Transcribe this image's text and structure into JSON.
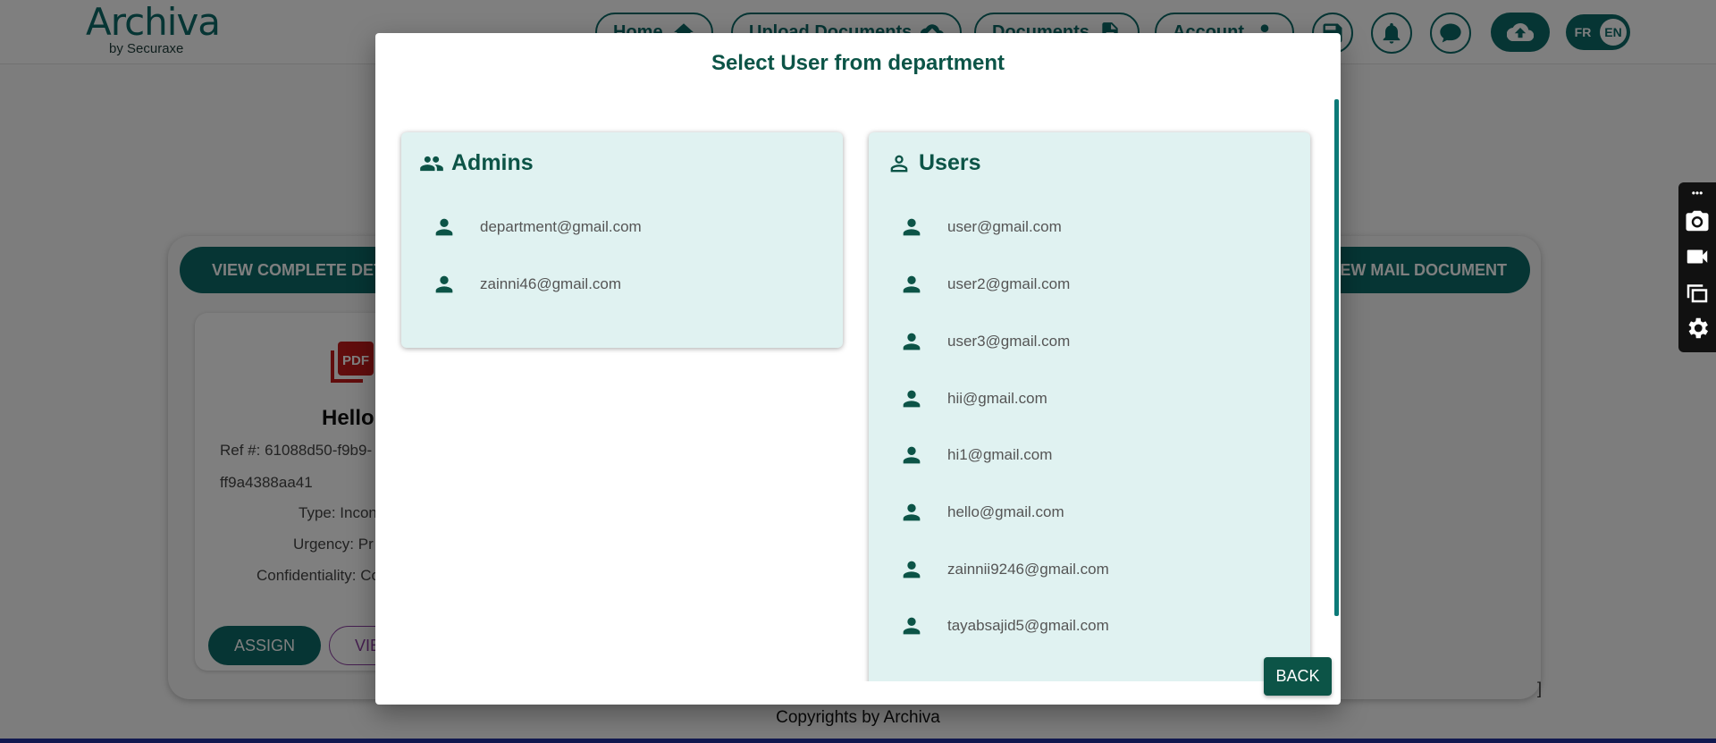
{
  "header": {
    "logo_text": "Archiva",
    "logo_sub": "by Securaxe",
    "nav": [
      {
        "label": "Home",
        "icon": "home-icon"
      },
      {
        "label": "Upload Documents",
        "icon": "cloud-upload-icon"
      },
      {
        "label": "Documents",
        "icon": "document-icon"
      },
      {
        "label": "Account",
        "icon": "person-icon"
      }
    ],
    "lang_fr": "FR",
    "lang_en": "EN"
  },
  "background_card": {
    "view_details_label": "VIEW COMPLETE DET",
    "view_mail_label": "EW MAIL DOCUMENT",
    "doc_title": "Hello",
    "ref_line1": "Ref #: 61088d50-f9b9-",
    "ref_line2": "ff9a4388aa41",
    "type_line": "Type: Incon",
    "urgency_line": "Urgency: Pr",
    "confidentiality_line": "Confidentiality: Co",
    "assign_label": "ASSIGN",
    "view_label": "VIE",
    "stray_char": "]"
  },
  "footer": {
    "text": "Copyrights by Archiva"
  },
  "modal": {
    "title": "Select User from department",
    "admins": {
      "title": "Admins",
      "items": [
        "department@gmail.com",
        "zainni46@gmail.com"
      ]
    },
    "users": {
      "title": "Users",
      "items": [
        "user@gmail.com",
        "user2@gmail.com",
        "user3@gmail.com",
        "hii@gmail.com",
        "hi1@gmail.com",
        "hello@gmail.com",
        "zainnii9246@gmail.com",
        "tayabsajid5@gmail.com"
      ]
    },
    "back_label": "BACK"
  },
  "toolbar": {
    "top_label": "•••",
    "icons": [
      "camera-icon",
      "video-icon",
      "window-icon",
      "settings-icon"
    ]
  },
  "colors": {
    "primary": "#0c6b68",
    "dark_primary": "#0c5447",
    "panel_bg": "#e0f2f1"
  }
}
